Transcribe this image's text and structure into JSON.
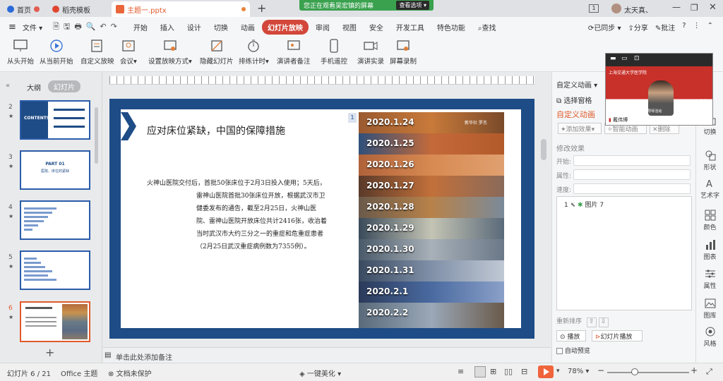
{
  "tabs": [
    {
      "label": "首页",
      "active": false
    },
    {
      "label": "稻壳模板",
      "active": false
    },
    {
      "label": "主题一.pptx",
      "active": true
    }
  ],
  "share_banner": {
    "text": "您正在观看吴宏镇的屏幕",
    "option": "查看选项"
  },
  "window": {
    "user_name": "太天真、",
    "page_badge": "1"
  },
  "menu": [
    "文件",
    "开始",
    "插入",
    "设计",
    "切换",
    "动画",
    "幻灯片放映",
    "审阅",
    "视图",
    "安全",
    "开发工具",
    "特色功能",
    "查找"
  ],
  "menu_right": {
    "sync": "已同步",
    "share": "分享",
    "annotate": "批注"
  },
  "ribbon": [
    "从头开始",
    "从当前开始",
    "自定义放映",
    "会议",
    "设置放映方式",
    "隐藏幻灯片",
    "排练计时",
    "演讲者备注",
    "手机遥控",
    "演讲实录",
    "屏幕录制"
  ],
  "left_panel": {
    "tabs": [
      "大纲",
      "幻灯片"
    ],
    "slides": [
      {
        "num": "2",
        "title": "CONTENTS"
      },
      {
        "num": "3",
        "title": "PART 01",
        "subtitle": "医院、床位的紧缺"
      },
      {
        "num": "4"
      },
      {
        "num": "5"
      },
      {
        "num": "6",
        "selected": true
      }
    ]
  },
  "slide": {
    "title": "应对床位紧缺，中国的保障措施",
    "body": "火神山医院交付后，首批50张床位于2月3日投入使用；5天后，雷神山医院首批30张床位开放，根据武汉市卫健委发布的通告，截至2月25日，火神山医院、雷神山医院开放床位共计2416张，收治着当时武汉市大约三分之一的重症和危重症患者（2月25日武汉重症病例数为7355例）。",
    "marker": "1",
    "photo_dates": [
      "2020.1.24",
      "2020.1.25",
      "2020.1.26",
      "2020.1.27",
      "2020.1.28",
      "2020.1.29",
      "2020.1.30",
      "2020.1.31",
      "2020.2.1",
      "2020.2.2"
    ],
    "photo_credit": "新华社  罗杰",
    "notes_placeholder": "单击此处添加备注"
  },
  "right_panel": {
    "title": "自定义动画",
    "select_pane": "选择窗格",
    "custom_anim": "自定义动画",
    "add_effect": "添加效果",
    "smart_anim": "智能动画",
    "delete": "删除",
    "modify_effect": "修改效果",
    "start_label": "开始:",
    "property_label": "属性:",
    "speed_label": "速度:",
    "list_item_num": "1",
    "list_item": "图片 7",
    "reorder": "重新排序",
    "play": "播放",
    "slideshow": "幻灯片播放",
    "autopreview": "自动预览"
  },
  "side_tools": [
    "切换",
    "形状",
    "艺术字",
    "颜色",
    "图表",
    "属性",
    "图库",
    "风格"
  ],
  "video": {
    "school": "上海交通大学医学院",
    "caption": "COVID 论坛",
    "sub": "——2020年 合格导师活动",
    "name": "戴伟博"
  },
  "status": {
    "slide_info": "幻灯片 6 / 21",
    "theme": "Office 主题",
    "protect": "文档未保护",
    "beautify": "一键美化",
    "zoom": "78%"
  },
  "colors": {
    "accent": "#d2473a",
    "slide_blue": "#1e4c86",
    "banner_green": "#3aa14e"
  }
}
